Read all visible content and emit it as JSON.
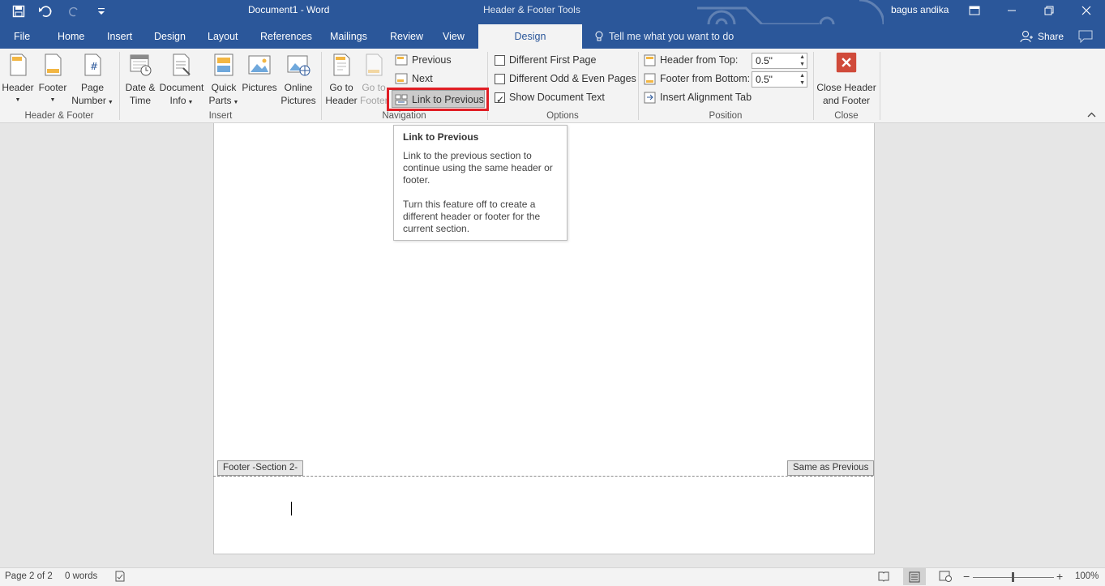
{
  "window": {
    "title": "Document1  -  Word",
    "context_tab_group": "Header & Footer Tools",
    "user": "bagus andika"
  },
  "qat": {
    "save": "save-icon",
    "undo": "undo-icon",
    "redo": "redo-icon",
    "customize": "customize-qat-icon"
  },
  "tabs": [
    {
      "label": "File"
    },
    {
      "label": "Home"
    },
    {
      "label": "Insert"
    },
    {
      "label": "Design"
    },
    {
      "label": "Layout"
    },
    {
      "label": "References"
    },
    {
      "label": "Mailings"
    },
    {
      "label": "Review"
    },
    {
      "label": "View"
    },
    {
      "label": "Design"
    }
  ],
  "tell_me": "Tell me what you want to do",
  "share": "Share",
  "ribbon": {
    "header_footer": {
      "label": "Header & Footer",
      "header": "Header",
      "footer": "Footer",
      "page": "Page",
      "number": "Number"
    },
    "insert": {
      "label": "Insert",
      "date": "Date &",
      "time": "Time",
      "document": "Document",
      "info": "Info",
      "quick": "Quick",
      "parts": "Parts",
      "pictures": "Pictures",
      "online": "Online",
      "online_pictures": "Pictures"
    },
    "navigation": {
      "label": "Navigation",
      "go_to": "Go to",
      "header": "Header",
      "go_to_2": "Go to",
      "footer": "Footer",
      "previous": "Previous",
      "next": "Next",
      "link_to_previous": "Link to Previous"
    },
    "options": {
      "label": "Options",
      "different_first_page": "Different First Page",
      "different_odd_even": "Different Odd & Even Pages",
      "show_document_text": "Show Document Text",
      "show_document_text_checked": true
    },
    "position": {
      "label": "Position",
      "header_from_top": "Header from Top:",
      "header_from_top_value": "0.5\"",
      "footer_from_bottom": "Footer from Bottom:",
      "footer_from_bottom_value": "0.5\"",
      "insert_alignment_tab": "Insert Alignment Tab"
    },
    "close": {
      "label": "Close",
      "close_header": "Close Header",
      "and_footer": "and Footer"
    }
  },
  "tooltip": {
    "title": "Link to Previous",
    "line1": "Link to the previous section to continue using the same header or footer.",
    "line2": "Turn this feature off to create a different header or footer for the current section."
  },
  "document": {
    "footer_tag": "Footer -Section 2-",
    "same_as_previous": "Same as Previous"
  },
  "status": {
    "page": "Page 2 of 2",
    "words": "0 words",
    "zoom": "100%",
    "zoom_minus": "−",
    "zoom_plus": "+"
  },
  "colors": {
    "brand": "#2b579a",
    "highlight": "#e01e25",
    "close_icon": "#d04a3a"
  }
}
